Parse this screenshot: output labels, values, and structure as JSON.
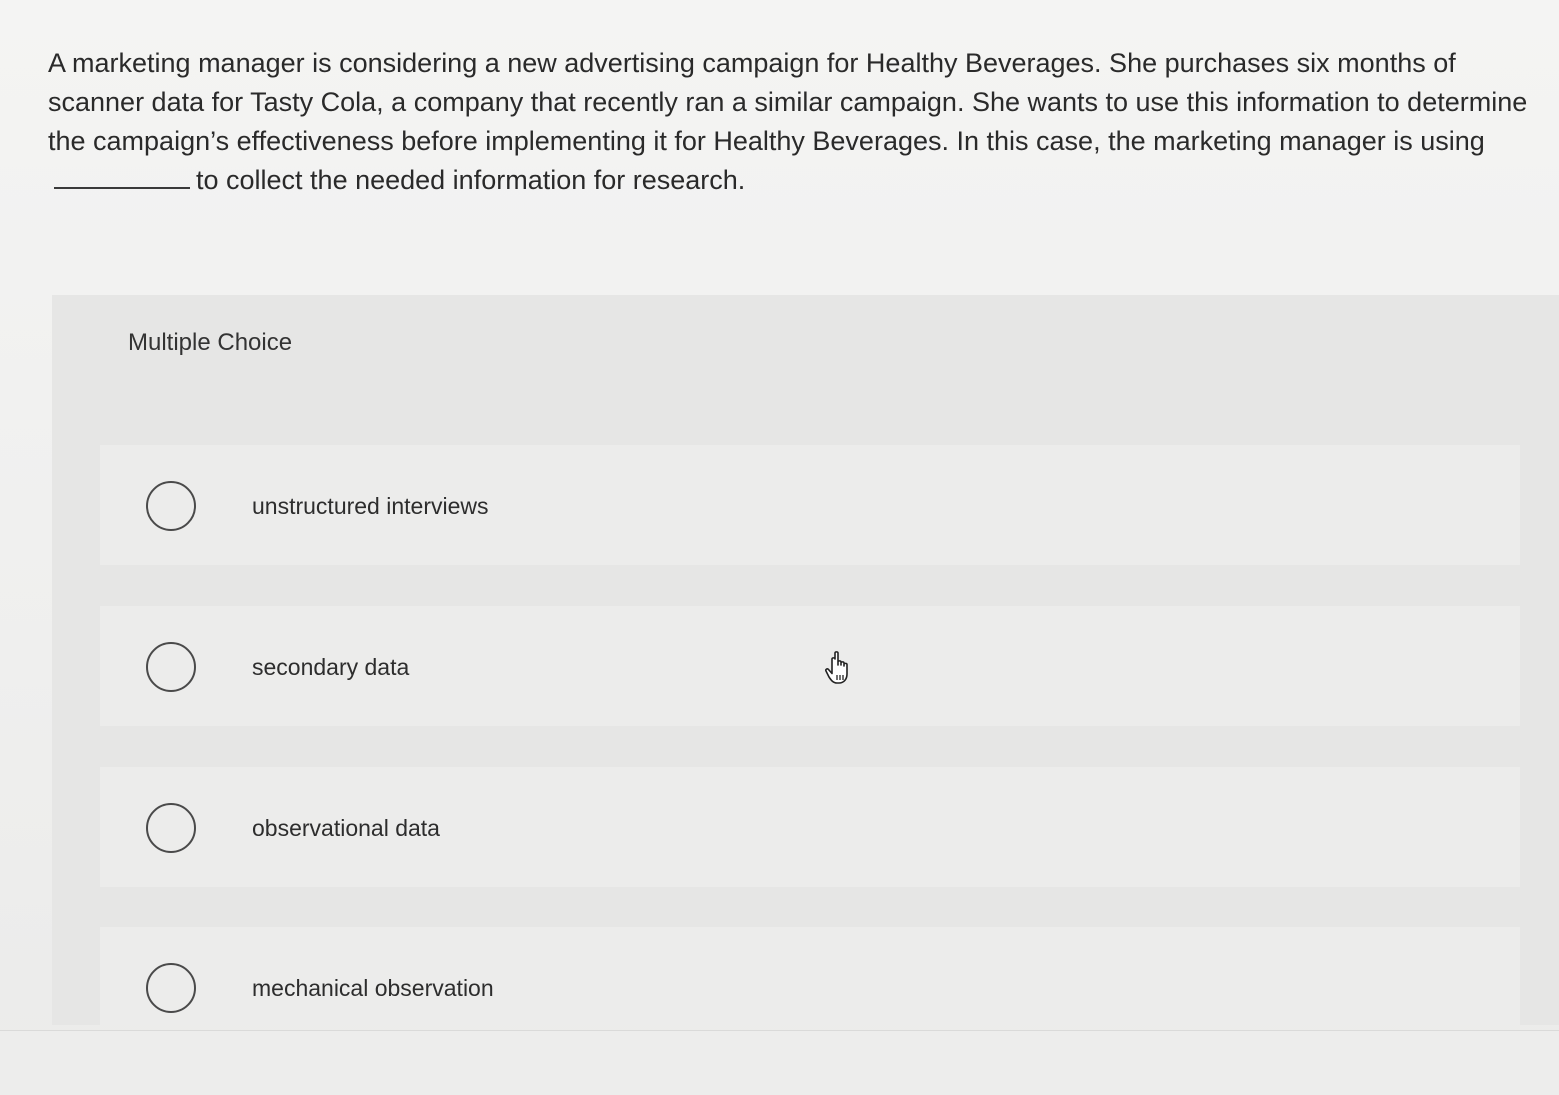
{
  "question": {
    "text_before": "A marketing manager is considering a new advertising campaign for Healthy Beverages. She purchases six months of scanner data for Tasty Cola, a company that recently ran a similar campaign. She wants to use this information to determine the campaign’s effectiveness before implementing it for Healthy Beverages. In this case, the marketing manager is using",
    "text_after": "to collect the needed information for research."
  },
  "multiple_choice": {
    "title": "Multiple Choice",
    "options": [
      {
        "label": "unstructured interviews",
        "selected": false
      },
      {
        "label": "secondary data",
        "selected": false
      },
      {
        "label": "observational data",
        "selected": false
      },
      {
        "label": "mechanical observation",
        "selected": false
      }
    ]
  },
  "icons": {
    "radio": "radio-circle-icon",
    "cursor": "hand-pointer-icon"
  }
}
